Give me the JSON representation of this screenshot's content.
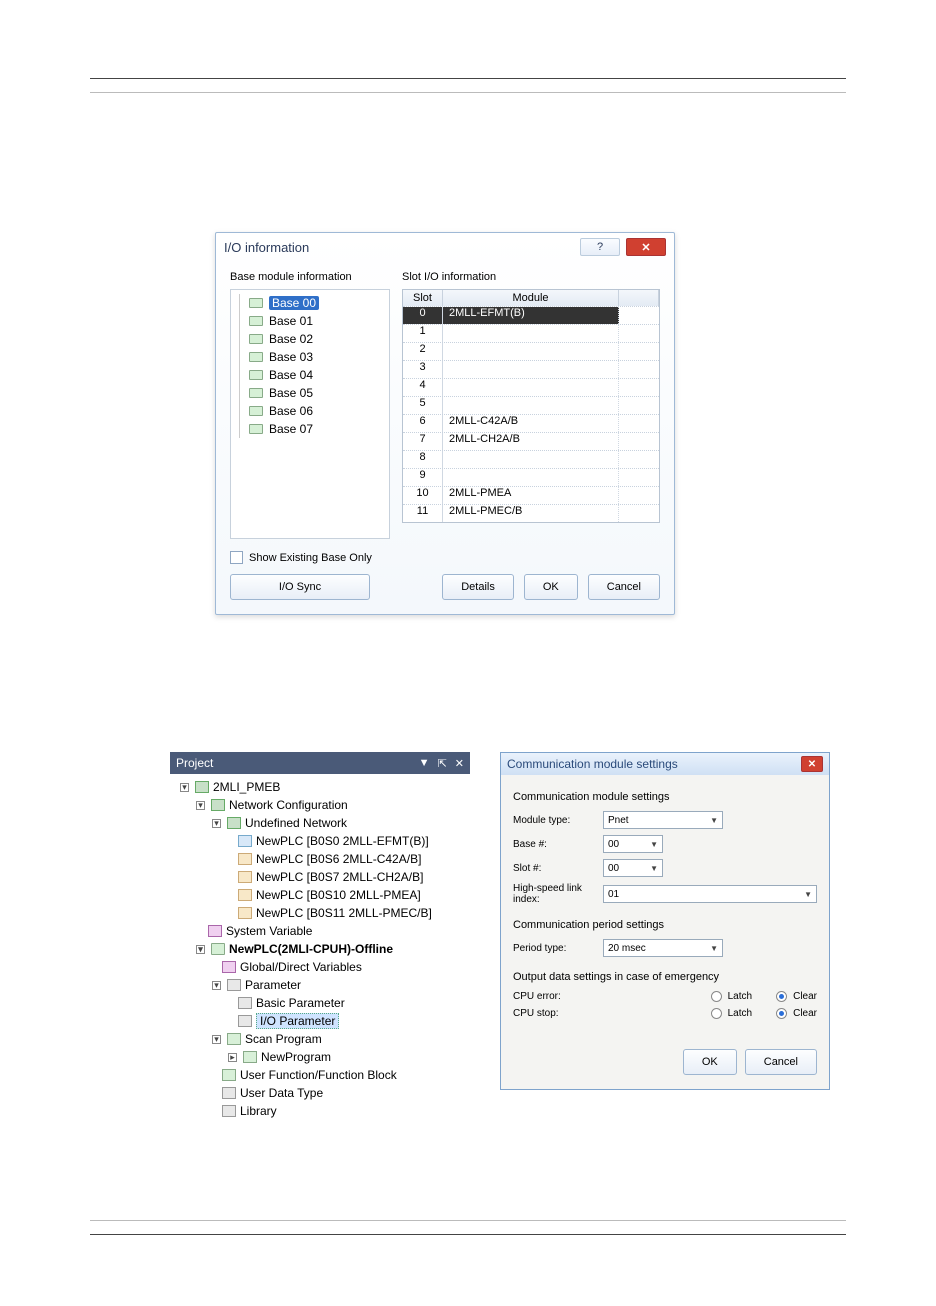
{
  "ioinfo": {
    "title": "I/O information",
    "help_glyph": "?",
    "close_glyph": "✕",
    "left_label": "Base module information",
    "right_label": "Slot I/O information",
    "bases": [
      "Base 00",
      "Base 01",
      "Base 02",
      "Base 03",
      "Base 04",
      "Base 05",
      "Base 06",
      "Base 07"
    ],
    "selected_base_index": 0,
    "grid_headers": {
      "slot": "Slot",
      "module": "Module"
    },
    "slots": [
      {
        "slot": "0",
        "module": "2MLL-EFMT(B)",
        "selected": true
      },
      {
        "slot": "1",
        "module": ""
      },
      {
        "slot": "2",
        "module": ""
      },
      {
        "slot": "3",
        "module": ""
      },
      {
        "slot": "4",
        "module": ""
      },
      {
        "slot": "5",
        "module": ""
      },
      {
        "slot": "6",
        "module": "2MLL-C42A/B"
      },
      {
        "slot": "7",
        "module": "2MLL-CH2A/B"
      },
      {
        "slot": "8",
        "module": ""
      },
      {
        "slot": "9",
        "module": ""
      },
      {
        "slot": "10",
        "module": "2MLL-PMEA"
      },
      {
        "slot": "11",
        "module": "2MLL-PMEC/B"
      }
    ],
    "show_existing_label": "Show Existing Base Only",
    "buttons": {
      "sync": "I/O Sync",
      "details": "Details",
      "ok": "OK",
      "cancel": "Cancel"
    }
  },
  "project": {
    "panel_title": "Project",
    "pin_glyph": "▼",
    "dock_glyph": "⇱",
    "close_glyph": "✕",
    "nodes": {
      "root": "2MLI_PMEB",
      "netconf": "Network Configuration",
      "undef": "Undefined Network",
      "n1": "NewPLC [B0S0 2MLL-EFMT(B)]",
      "n2": "NewPLC [B0S6 2MLL-C42A/B]",
      "n3": "NewPLC [B0S7 2MLL-CH2A/B]",
      "n4": "NewPLC [B0S10 2MLL-PMEA]",
      "n5": "NewPLC [B0S11 2MLL-PMEC/B]",
      "sysvar": "System Variable",
      "plc": "NewPLC(2MLI-CPUH)-Offline",
      "globals": "Global/Direct Variables",
      "param": "Parameter",
      "basicpar": "Basic Parameter",
      "iopar": "I/O Parameter",
      "scan": "Scan Program",
      "newprog": "NewProgram",
      "ufb": "User Function/Function Block",
      "udt": "User Data Type",
      "lib": "Library"
    }
  },
  "comm": {
    "title": "Communication module settings",
    "section1": "Communication module settings",
    "module_type_label": "Module type:",
    "module_type_value": "Pnet",
    "base_label": "Base #:",
    "base_value": "00",
    "slot_label": "Slot #:",
    "slot_value": "00",
    "hsl_label": "High-speed link index:",
    "hsl_value": "01",
    "section2": "Communication period settings",
    "period_label": "Period type:",
    "period_value": "20 msec",
    "section3": "Output data settings in case of emergency",
    "cpu_error_label": "CPU error:",
    "cpu_stop_label": "CPU stop:",
    "latch_label": "Latch",
    "clear_label": "Clear",
    "ok": "OK",
    "cancel": "Cancel"
  }
}
